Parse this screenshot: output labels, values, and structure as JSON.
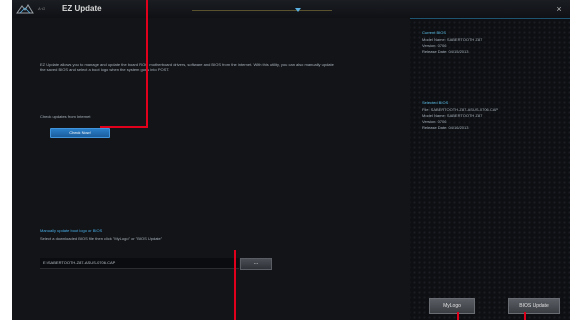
{
  "titlebar": {
    "logo_text": "A·G",
    "title": "EZ Update",
    "close": "×"
  },
  "main": {
    "description": "EZ Update allows you to manage and update the board ROG motherboard drivers, software and BIOS from the internet. With this utility, you can also manually update the saved BIOS and select a boot logo when the system goes into POST.",
    "check_label": "Check updates from Internet",
    "check_button": "Check Now!",
    "manual_title": "Manually update boot logo or BIOS",
    "manual_desc": "Select a downloaded BIOS file then click \"MyLogo\" or \"BIOS Update\"",
    "file_path": "E:\\SABERTOOTH-Z87-ASUS-0706.CAP",
    "browse_label": "..."
  },
  "side": {
    "current_heading": "Current BIOS",
    "current_lines": [
      "Model Name: SABERTOOTH Z87",
      "Version: 0706",
      "Release Date: 04/15/2013"
    ],
    "selected_heading": "Selected BIOS",
    "selected_lines": [
      "File: SABERTOOTH-Z87-ASUS-0706.CAP",
      "Model Name: SABERTOOTH Z87",
      "Version: 0706",
      "Release Date: 04/16/2013"
    ]
  },
  "footer": {
    "mylogo_label": "MyLogo",
    "bios_update_label": "BIOS Update"
  },
  "colors": {
    "accent": "#4ab0ea",
    "annotation": "#e0001c",
    "primary_button": "#1f6db3"
  }
}
